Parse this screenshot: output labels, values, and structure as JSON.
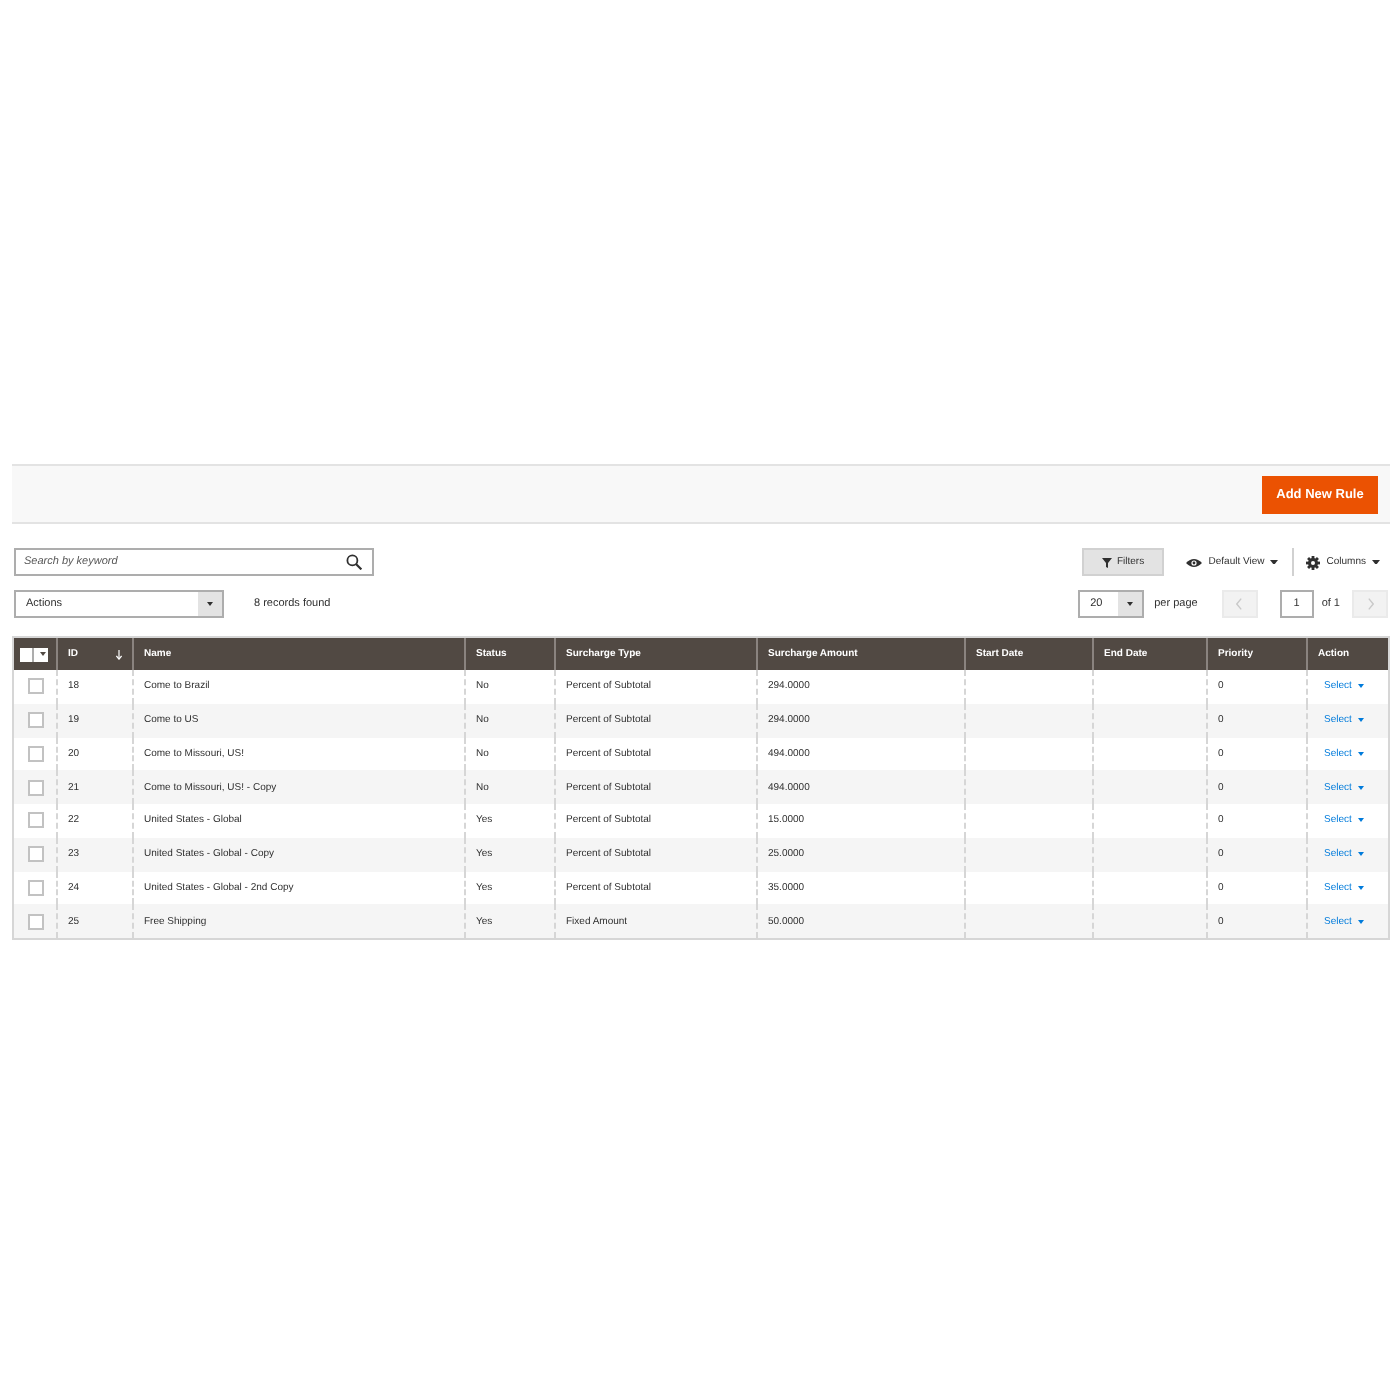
{
  "header": {
    "add_button": "Add New Rule"
  },
  "search": {
    "placeholder": "Search by keyword"
  },
  "controls": {
    "filters": "Filters",
    "view": "Default View",
    "columns": "Columns"
  },
  "mass_action": {
    "value": "Actions"
  },
  "records_found": "8 records found",
  "pagination": {
    "page_size": "20",
    "per_page_label": "per page",
    "page": "1",
    "total": "of 1",
    "prev_disabled": true,
    "next_disabled": true
  },
  "table": {
    "select_all": {
      "checked": false
    },
    "columns": [
      {
        "label": "ID",
        "sorted": true
      },
      {
        "label": "Name",
        "sorted": false
      },
      {
        "label": "Status",
        "sorted": false
      },
      {
        "label": "Surcharge Type",
        "sorted": false
      },
      {
        "label": "Surcharge Amount",
        "sorted": false
      },
      {
        "label": "Start Date",
        "sorted": false
      },
      {
        "label": "End Date",
        "sorted": false
      },
      {
        "label": "Priority",
        "sorted": false
      },
      {
        "label": "Action",
        "sorted": false
      }
    ],
    "rows": [
      {
        "checked": false,
        "id": "18",
        "name": "Come to Brazil",
        "status": "No",
        "surcharge_type": "Percent of Subtotal",
        "surcharge_amount": "294.0000",
        "priority": "0",
        "action": "Select"
      },
      {
        "checked": false,
        "id": "19",
        "name": "Come to US",
        "status": "No",
        "surcharge_type": "Percent of Subtotal",
        "surcharge_amount": "294.0000",
        "priority": "0",
        "action": "Select"
      },
      {
        "checked": false,
        "id": "20",
        "name": "Come to Missouri, US!",
        "status": "No",
        "surcharge_type": "Percent of Subtotal",
        "surcharge_amount": "494.0000",
        "priority": "0",
        "action": "Select"
      },
      {
        "checked": false,
        "id": "21",
        "name": "Come to Missouri, US! - Copy",
        "status": "No",
        "surcharge_type": "Percent of Subtotal",
        "surcharge_amount": "494.0000",
        "priority": "0",
        "action": "Select"
      },
      {
        "checked": false,
        "id": "22",
        "name": "United States - Global",
        "status": "Yes",
        "surcharge_type": "Percent of Subtotal",
        "surcharge_amount": "15.0000",
        "priority": "0",
        "action": "Select"
      },
      {
        "checked": false,
        "id": "23",
        "name": "United States - Global - Copy",
        "status": "Yes",
        "surcharge_type": "Percent of Subtotal",
        "surcharge_amount": "25.0000",
        "priority": "0",
        "action": "Select"
      },
      {
        "checked": false,
        "id": "24",
        "name": "United States - Global - 2nd Copy",
        "status": "Yes",
        "surcharge_type": "Percent of Subtotal",
        "surcharge_amount": "35.0000",
        "priority": "0",
        "action": "Select"
      },
      {
        "checked": false,
        "id": "25",
        "name": "Free Shipping",
        "status": "Yes",
        "surcharge_type": "Fixed Amount",
        "surcharge_amount": "50.0000",
        "priority": "0",
        "action": "Select"
      }
    ]
  }
}
